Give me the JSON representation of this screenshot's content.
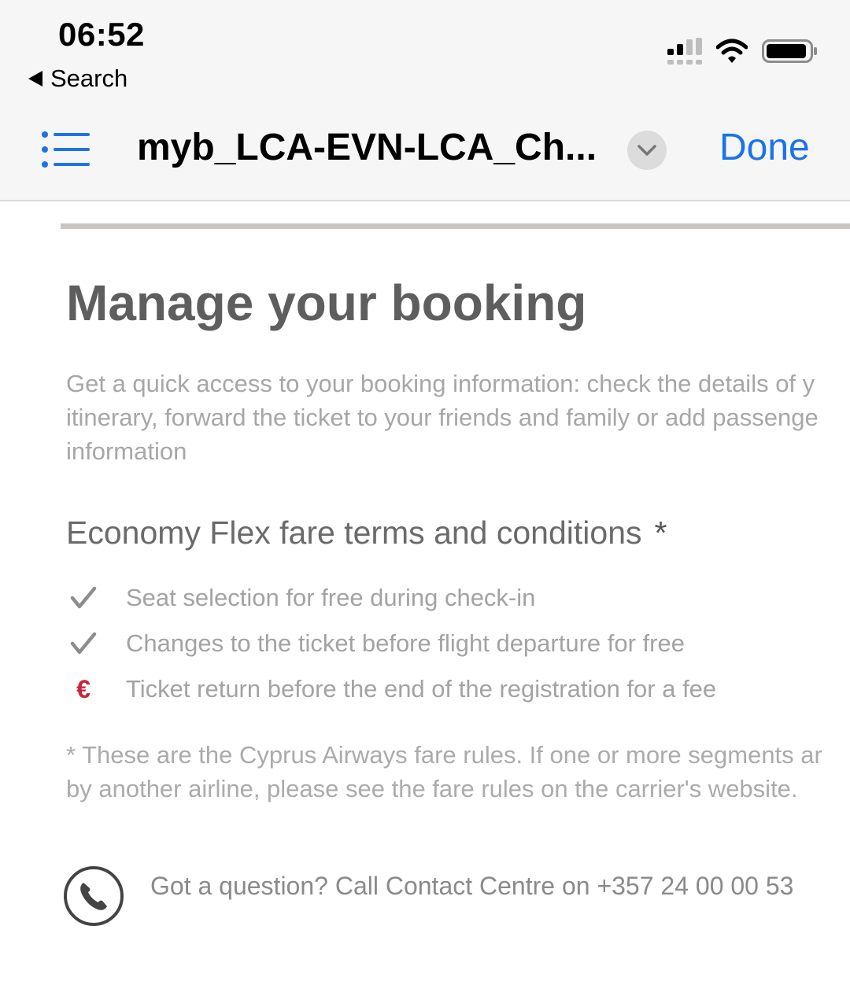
{
  "status_bar": {
    "time": "06:52",
    "back_label": "Search",
    "icons": [
      "cellular-signal-icon",
      "wifi-icon",
      "battery-icon"
    ]
  },
  "nav_bar": {
    "menu_icon": "list-icon",
    "document_title": "myb_LCA-EVN-LCA_Ch...",
    "dropdown_icon": "chevron-down-icon",
    "done_label": "Done",
    "accent_color": "#1a73e8"
  },
  "document": {
    "heading": "Manage your booking",
    "intro_lines": [
      "Get a quick access to your booking information: check the details of y",
      "itinerary, forward the ticket to your friends and family or add passenge",
      "information"
    ],
    "fare_title": "Economy Flex fare terms and conditions",
    "fare_title_marker": "*",
    "terms": [
      {
        "icon": "checkmark-icon",
        "text": "Seat selection for free during check-in"
      },
      {
        "icon": "checkmark-icon",
        "text": "Changes to the ticket before flight departure for free"
      },
      {
        "icon": "euro-icon",
        "glyph": "€",
        "text": "Ticket return before the end of the registration for a fee"
      }
    ],
    "footnote_lines": [
      "* These are the Cyprus Airways fare rules. If one or more segments ar",
      "by another airline, please see the fare rules on the carrier's website."
    ],
    "contact_icon": "phone-icon",
    "contact_text": "Got a question? Call Contact Centre on +357 24 00 00 53",
    "euro_color": "#c8253a"
  }
}
